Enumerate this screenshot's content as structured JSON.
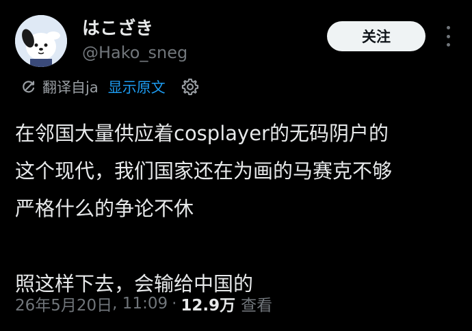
{
  "author": {
    "display_name": "はこざき",
    "handle": "@Hako_sneg",
    "avatar_icon": "pochacco-avatar-icon"
  },
  "actions": {
    "follow_label": "关注",
    "more_icon": "more-dots-icon"
  },
  "translation": {
    "translate_icon": "translate-icon",
    "translated_from": "翻译自ja",
    "show_original": "显示原文",
    "settings_icon": "gear-icon"
  },
  "tweet": {
    "lines": [
      "在邻国大量供应着cosplayer的无码阴户的",
      "这个现代，我们国家还在为画的马赛克不够",
      "严格什么的争论不休",
      "",
      "照这样下去，会输给中国的"
    ]
  },
  "meta": {
    "date": "26年5月20日",
    "time": "11:09",
    "separator": "·",
    "views_count": "12.9万",
    "views_label": "查看"
  },
  "colors": {
    "background": "#000000",
    "text": "#e7e9ea",
    "secondary": "#71767b",
    "link": "#1d9bf0",
    "button_bg": "#eff3f4"
  }
}
